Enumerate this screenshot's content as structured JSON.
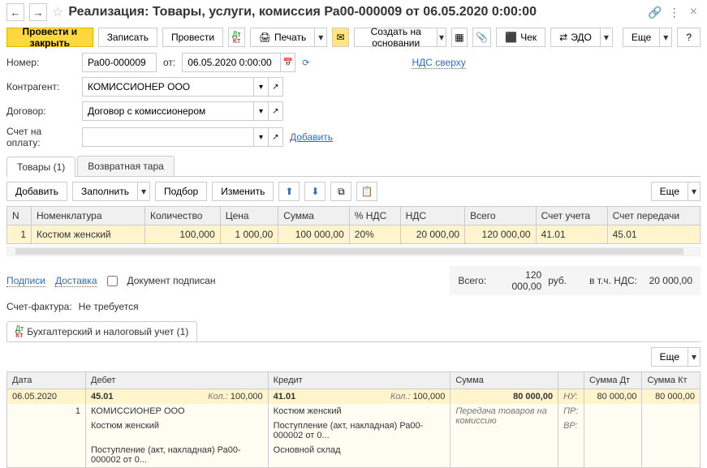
{
  "header": {
    "title": "Реализация: Товары, услуги, комиссия Ра00-000009 от 06.05.2020 0:00:00"
  },
  "toolbar": {
    "post_close": "Провести и закрыть",
    "write": "Записать",
    "post": "Провести",
    "print": "Печать",
    "create_based": "Создать на основании",
    "check": "Чек",
    "edo": "ЭДО",
    "more": "Еще",
    "help": "?"
  },
  "form": {
    "number_label": "Номер:",
    "number_value": "Ра00-000009",
    "from_label": "от:",
    "date_value": "06.05.2020 0:00:00",
    "vat_link": "НДС сверху",
    "contractor_label": "Контрагент:",
    "contractor_value": "КОМИССИОНЕР ООО",
    "contract_label": "Договор:",
    "contract_value": "Договор с комиссионером",
    "account_label": "Счет на оплату:",
    "account_value": "",
    "add_link": "Добавить"
  },
  "tabs": {
    "goods": "Товары (1)",
    "returnable": "Возвратная тара"
  },
  "goods_toolbar": {
    "add": "Добавить",
    "fill": "Заполнить",
    "select": "Подбор",
    "change": "Изменить",
    "more": "Еще"
  },
  "goods_table": {
    "headers": {
      "n": "N",
      "nomen": "Номенклатура",
      "qty": "Количество",
      "price": "Цена",
      "sum": "Сумма",
      "vat_pct": "% НДС",
      "vat": "НДС",
      "total": "Всего",
      "acct": "Счет учета",
      "acct_tr": "Счет передачи"
    },
    "rows": [
      {
        "n": "1",
        "nomen": "Костюм женский",
        "qty": "100,000",
        "price": "1 000,00",
        "sum": "100 000,00",
        "vat_pct": "20%",
        "vat": "20 000,00",
        "total": "120 000,00",
        "acct": "41.01",
        "acct_tr": "45.01"
      }
    ]
  },
  "footer": {
    "signatures": "Подписи",
    "delivery": "Доставка",
    "doc_signed": "Документ подписан",
    "total_label": "Всего:",
    "total_value": "120 000,00",
    "currency": "руб.",
    "vat_label": "в т.ч. НДС:",
    "vat_value": "20 000,00",
    "invoice_label": "Счет-фактура:",
    "invoice_value": "Не требуется"
  },
  "accounting": {
    "tab": "Бухгалтерский и налоговый учет (1)",
    "more": "Еще",
    "headers": {
      "date": "Дата",
      "debit": "Дебет",
      "credit": "Кредит",
      "sum": "Сумма",
      "sum_dt": "Сумма Дт",
      "sum_kt": "Сумма Кт"
    },
    "row": {
      "date": "06.05.2020",
      "seq": "1",
      "debit_acc": "45.01",
      "debit_qty_label": "Кол.:",
      "debit_qty": "100,000",
      "debit_sub1": "КОМИССИОНЕР ООО",
      "debit_sub2": "Костюм женский",
      "debit_sub3": "Поступление (акт, накладная) Ра00-000002 от 0...",
      "credit_acc": "41.01",
      "credit_qty_label": "Кол.:",
      "credit_qty": "100,000",
      "credit_sub1": "Костюм женский",
      "credit_sub2": "Поступление (акт, накладная) Ра00-000002 от 0...",
      "credit_sub3": "Основной склад",
      "sum": "80 000,00",
      "sum_desc": "Передача товаров на комиссию",
      "nu": "НУ:",
      "pr": "ПР:",
      "vr": "ВР:",
      "sum_dt": "80 000,00",
      "sum_kt": "80 000,00"
    }
  }
}
